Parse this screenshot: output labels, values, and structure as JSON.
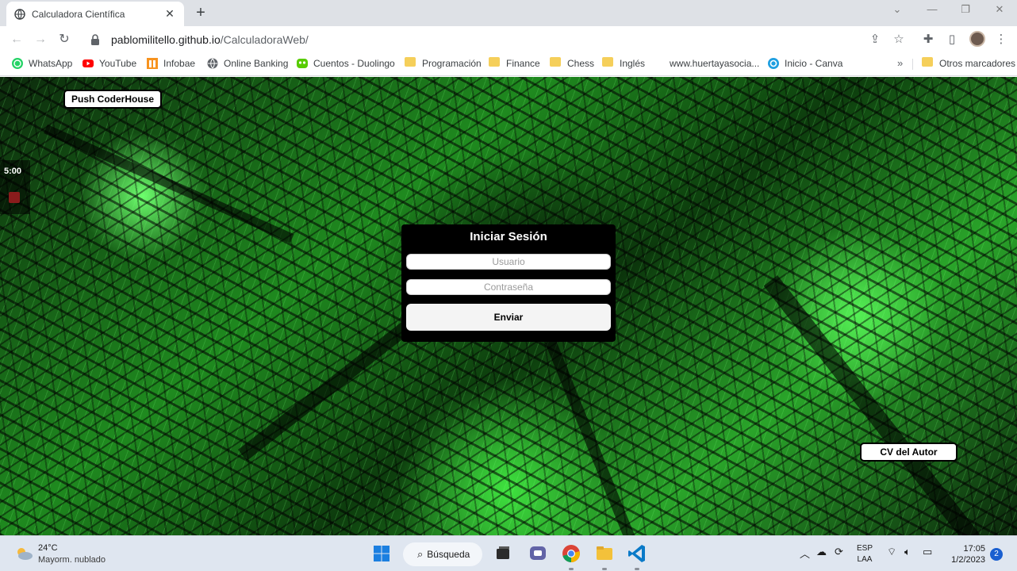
{
  "browser": {
    "tab": {
      "title": "Calculadora Científica"
    },
    "url": {
      "host": "pablomilitello.github.io",
      "path": "/CalculadoraWeb/"
    },
    "bookmarks": [
      {
        "label": "WhatsApp",
        "icon": "whatsapp-icon"
      },
      {
        "label": "YouTube",
        "icon": "youtube-icon"
      },
      {
        "label": "Infobae",
        "icon": "infobae-icon"
      },
      {
        "label": "Online Banking",
        "icon": "globe-icon"
      },
      {
        "label": "Cuentos - Duolingo",
        "icon": "duolingo-icon"
      },
      {
        "label": "Programación",
        "icon": "folder-icon"
      },
      {
        "label": "Finance",
        "icon": "folder-icon"
      },
      {
        "label": "Chess",
        "icon": "folder-icon"
      },
      {
        "label": "Inglés",
        "icon": "folder-icon"
      },
      {
        "label": "www.huertayasocia...",
        "icon": "page-icon"
      },
      {
        "label": "Inicio - Canva",
        "icon": "canva-icon"
      }
    ],
    "other_bookmarks": "Otros marcadores",
    "overflow": "»"
  },
  "page": {
    "push_button": "Push CoderHouse",
    "timer": "5:00",
    "login": {
      "title": "Iniciar Sesión",
      "user_placeholder": "Usuario",
      "password_placeholder": "Contraseña",
      "submit": "Enviar"
    },
    "cv_button": "CV del Autor"
  },
  "taskbar": {
    "weather": {
      "temp": "24°C",
      "desc": "Mayorm. nublado"
    },
    "search": "Búsqueda",
    "lang": {
      "line1": "ESP",
      "line2": "LAA"
    },
    "clock": {
      "time": "17:05",
      "date": "1/2/2023"
    },
    "notifications": "2"
  },
  "colors": {
    "chrome_bg": "#dee1e6",
    "panel_bg": "#000000",
    "matrix_green": "#2aa52a",
    "taskbar_bg": "#dfe6f0"
  }
}
